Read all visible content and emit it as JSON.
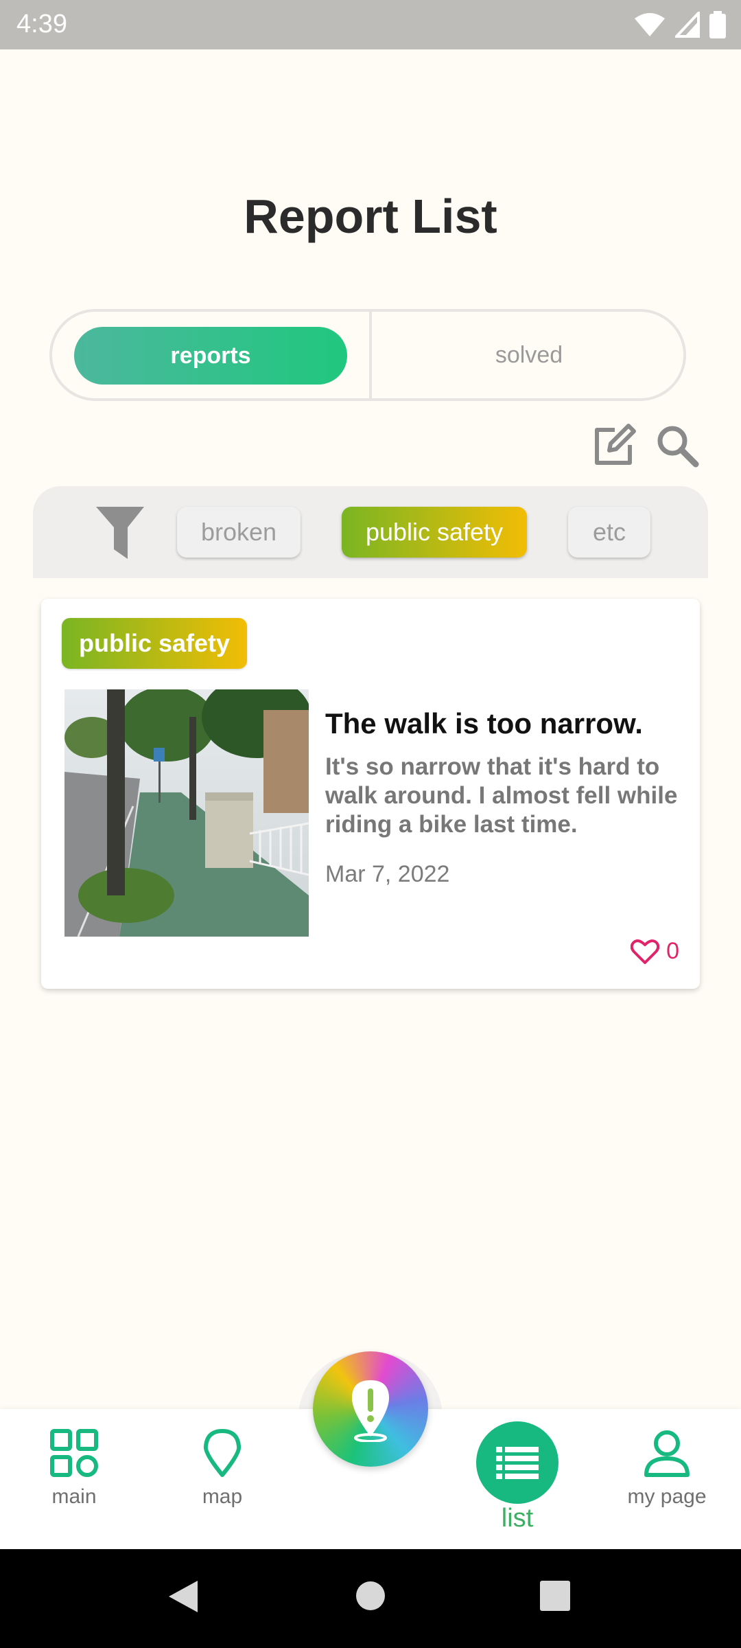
{
  "status_bar": {
    "time": "4:39"
  },
  "page": {
    "title": "Report List"
  },
  "tabs": {
    "reports": "reports",
    "solved": "solved"
  },
  "toolbar": {
    "edit_icon": "edit-icon",
    "search_icon": "search-icon"
  },
  "filters": {
    "icon": "filter-icon",
    "chips": [
      "broken",
      "public safety",
      "etc"
    ],
    "selected": "public safety"
  },
  "report": {
    "tag": "public safety",
    "title": "The walk is too narrow.",
    "body": "It's so narrow that it's hard to walk around. I almost fell while riding a bike last time.",
    "date": "Mar 7, 2022",
    "likes": "0"
  },
  "bottom_nav": {
    "main": "main",
    "map": "map",
    "list": "list",
    "my_page": "my page"
  },
  "colors": {
    "accent_green": "#17b980",
    "safety_gradient": [
      "#7ab523",
      "#f2bd05"
    ],
    "like_pink": "#e0246a"
  }
}
